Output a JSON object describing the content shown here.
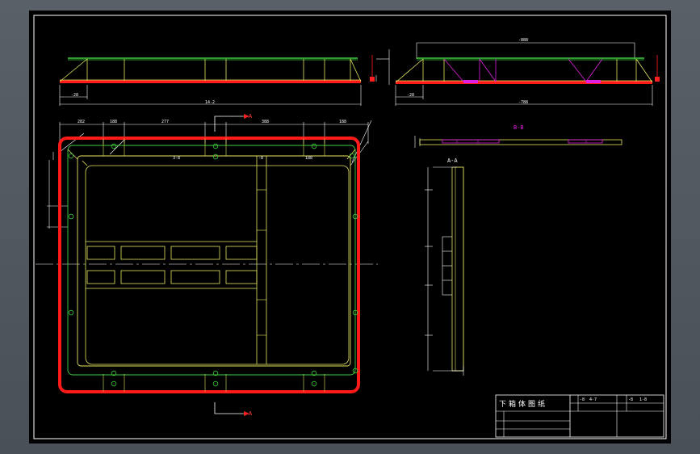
{
  "colors": {
    "frame": "#ffffff",
    "yellow": "#e8e860",
    "green": "#40d040",
    "red": "#ff1a1a",
    "magenta": "#e020e0",
    "white": "#ffffff",
    "section_arrow": "#ff2020"
  },
  "top_view": {
    "section_marker_top": "A",
    "section_marker_bottom": "A",
    "dims": [
      "282",
      "188",
      "277",
      "388",
      "188",
      "3-8",
      "-8",
      "188"
    ]
  },
  "front_view_left": {
    "dim_bottom_short": "-28",
    "dim_bottom_long": "14-2"
  },
  "front_view_right": {
    "dim_top": "-888",
    "dim_bottom_short": "-28",
    "dim_bottom_long": "-788"
  },
  "section_bb": {
    "label": "B-B"
  },
  "section_aa": {
    "label": "A-A"
  },
  "title_block": {
    "title": "下箱体图纸",
    "cells": [
      "-8",
      "4-7",
      "-8",
      "1-8"
    ]
  }
}
